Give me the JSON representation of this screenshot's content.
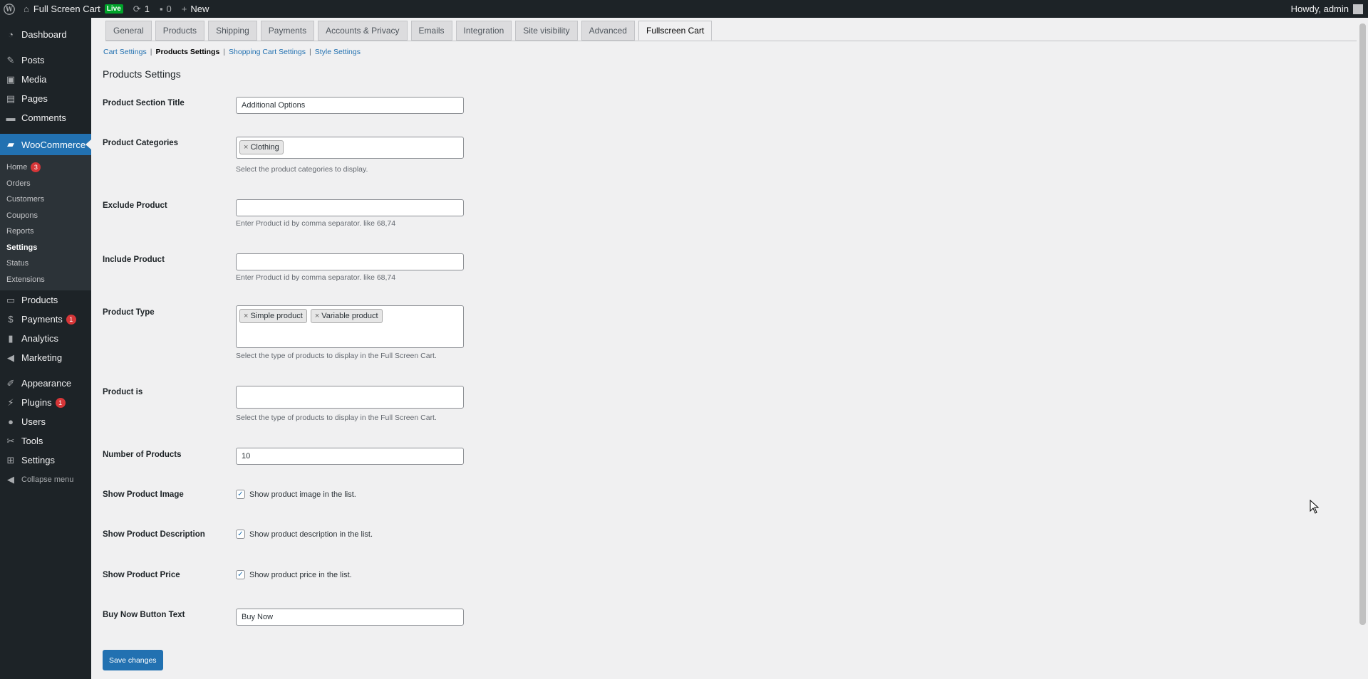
{
  "adminbar": {
    "site_name": "Full Screen Cart",
    "live_badge": "Live",
    "updates_count": "1",
    "comments_count": "0",
    "new_label": "New",
    "howdy": "Howdy, admin"
  },
  "sidebar": {
    "items_top": [
      {
        "label": "Dashboard",
        "icon": "dashboard-icon"
      },
      {
        "label": "Posts",
        "icon": "pin-icon"
      },
      {
        "label": "Media",
        "icon": "media-icon"
      },
      {
        "label": "Pages",
        "icon": "pages-icon"
      },
      {
        "label": "Comments",
        "icon": "comment-icon"
      },
      {
        "label": "WooCommerce",
        "icon": "woo-icon"
      }
    ],
    "woo_sub": [
      {
        "label": "Home",
        "badge": "3"
      },
      {
        "label": "Orders"
      },
      {
        "label": "Customers"
      },
      {
        "label": "Coupons"
      },
      {
        "label": "Reports"
      },
      {
        "label": "Settings"
      },
      {
        "label": "Status"
      },
      {
        "label": "Extensions"
      }
    ],
    "items_bottom": [
      {
        "label": "Products"
      },
      {
        "label": "Payments",
        "badge": "1"
      },
      {
        "label": "Analytics"
      },
      {
        "label": "Marketing"
      },
      {
        "label": "Appearance"
      },
      {
        "label": "Plugins",
        "badge": "1"
      },
      {
        "label": "Users"
      },
      {
        "label": "Tools"
      },
      {
        "label": "Settings"
      },
      {
        "label": "Collapse menu"
      }
    ]
  },
  "tabs": [
    "General",
    "Products",
    "Shipping",
    "Payments",
    "Accounts & Privacy",
    "Emails",
    "Integration",
    "Site visibility",
    "Advanced",
    "Fullscreen Cart"
  ],
  "subsub": {
    "cart_settings": "Cart Settings",
    "products_settings": "Products Settings",
    "shopping_cart_settings": "Shopping Cart Settings",
    "style_settings": "Style Settings"
  },
  "section_title": "Products Settings",
  "fields": {
    "section_title": {
      "label": "Product Section Title",
      "value": "Additional Options"
    },
    "categories": {
      "label": "Product Categories",
      "chips": [
        "Clothing"
      ],
      "desc": "Select the product categories to display."
    },
    "exclude": {
      "label": "Exclude Product",
      "value": "",
      "desc": "Enter Product id by comma separator. like 68,74"
    },
    "include": {
      "label": "Include Product",
      "value": "",
      "desc": "Enter Product id by comma separator. like 68,74"
    },
    "type": {
      "label": "Product Type",
      "chips": [
        "Simple product",
        "Variable product"
      ],
      "desc": "Select the type of products to display in the Full Screen Cart."
    },
    "product_is": {
      "label": "Product is",
      "value": "",
      "desc": "Select the type of products to display in the Full Screen Cart."
    },
    "number": {
      "label": "Number of Products",
      "value": "10"
    },
    "show_image": {
      "label": "Show Product Image",
      "check": "Show product image in the list.",
      "checked": true
    },
    "show_desc": {
      "label": "Show Product Description",
      "check": "Show product description in the list.",
      "checked": true
    },
    "show_price": {
      "label": "Show Product Price",
      "check": "Show product price in the list.",
      "checked": true
    },
    "buy_now": {
      "label": "Buy Now Button Text",
      "value": "Buy Now"
    }
  },
  "save_button": "Save changes"
}
